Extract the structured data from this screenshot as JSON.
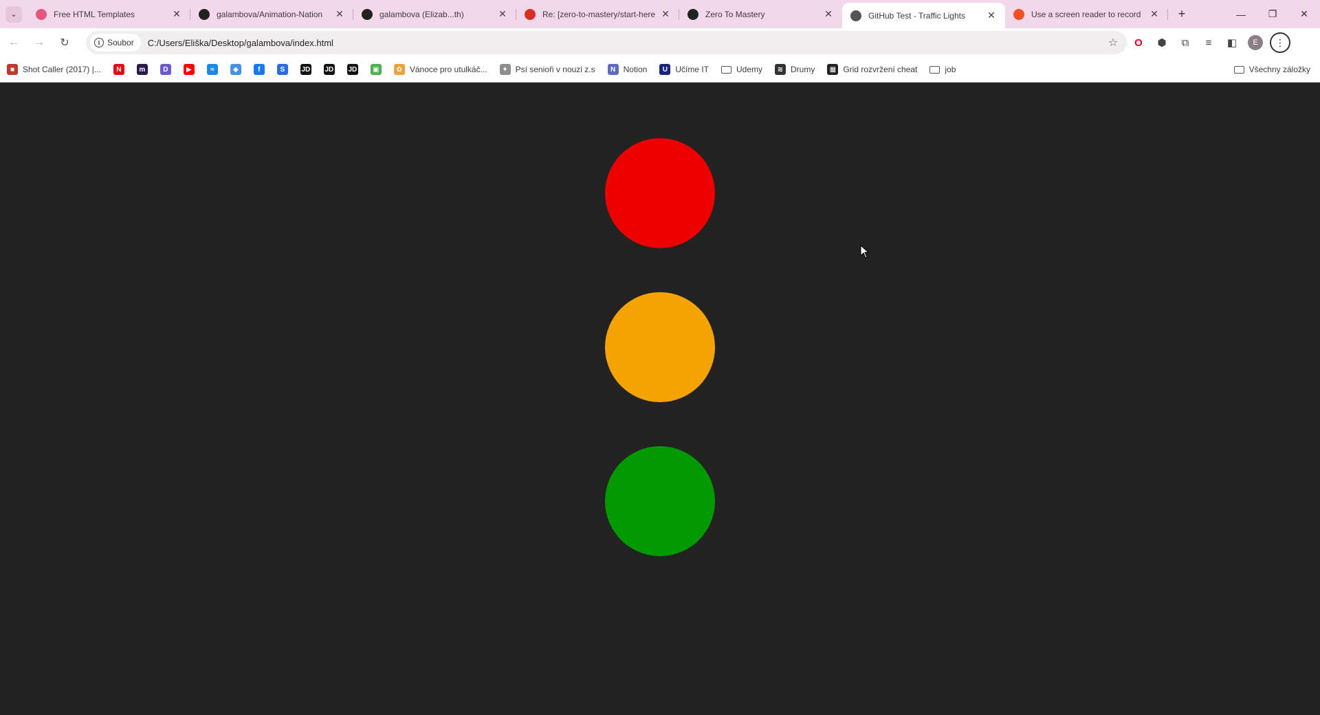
{
  "tabs": [
    {
      "title": "Free HTML Templates",
      "color": "#e75480",
      "active": false
    },
    {
      "title": "galambova/Animation-Nation",
      "color": "#222222",
      "active": false
    },
    {
      "title": "galambova (Elizab...th)",
      "color": "#222222",
      "active": false
    },
    {
      "title": "Re: [zero-to-mastery/start-here",
      "color": "#d93025",
      "active": false
    },
    {
      "title": "Zero To Mastery",
      "color": "#222222",
      "active": false
    },
    {
      "title": "GitHub Test - Traffic Lights",
      "color": "#555555",
      "active": true
    },
    {
      "title": "Use a screen reader to record",
      "color": "#f25022",
      "active": false
    }
  ],
  "toolbar": {
    "site_chip": "Soubor",
    "url": "C:/Users/Eliška/Desktop/galambova/index.html",
    "profile_initial": "E"
  },
  "bookmarks": [
    {
      "label": "Shot Caller (2017) |...",
      "color": "#c0392b",
      "glyph": "■"
    },
    {
      "label": "",
      "color": "#e50914",
      "glyph": "N"
    },
    {
      "label": "",
      "color": "#2b1a4a",
      "glyph": "m"
    },
    {
      "label": "",
      "color": "#6a5acd",
      "glyph": "D"
    },
    {
      "label": "",
      "color": "#ff0000",
      "glyph": "▶"
    },
    {
      "label": "",
      "color": "#1e88e5",
      "glyph": "≈"
    },
    {
      "label": "",
      "color": "#4a90e2",
      "glyph": "◆"
    },
    {
      "label": "",
      "color": "#1877f2",
      "glyph": "f"
    },
    {
      "label": "",
      "color": "#2d6cdf",
      "glyph": "S"
    },
    {
      "label": "",
      "color": "#111111",
      "glyph": "JD"
    },
    {
      "label": "",
      "color": "#111111",
      "glyph": "JD"
    },
    {
      "label": "",
      "color": "#111111",
      "glyph": "JD"
    },
    {
      "label": "",
      "color": "#4caf50",
      "glyph": "▣"
    },
    {
      "label": "Vánoce pro utulkáč...",
      "color": "#e6a23c",
      "glyph": "✿"
    },
    {
      "label": "Psí senioři v nouzi z.s",
      "color": "#8d8d8d",
      "glyph": "✦"
    },
    {
      "label": "Notion",
      "color": "#5c6bc0",
      "glyph": "N"
    },
    {
      "label": "Učíme IT",
      "color": "#1a237e",
      "glyph": "U"
    },
    {
      "label": "Udemy",
      "color": "folder",
      "glyph": ""
    },
    {
      "label": "Drumy",
      "color": "#333333",
      "glyph": "≋"
    },
    {
      "label": "Grid rozvržení cheat",
      "color": "#222222",
      "glyph": "▦"
    },
    {
      "label": "job",
      "color": "folder",
      "glyph": ""
    }
  ],
  "bookmarks_right": "Všechny záložky",
  "lights": {
    "red": "#ee0000",
    "amber": "#f5a300",
    "green": "#009900"
  }
}
